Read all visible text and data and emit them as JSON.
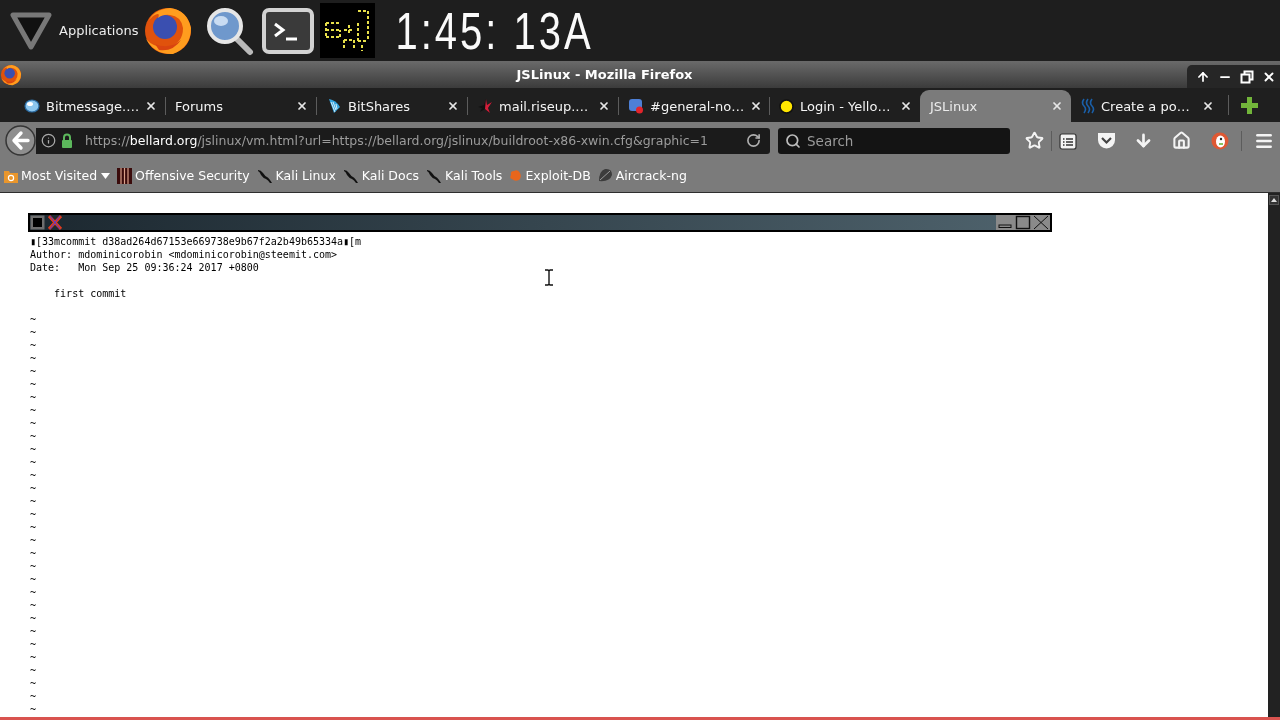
{
  "panel": {
    "menu_label": "Applications",
    "clock": "1:45: 13A"
  },
  "window": {
    "title": "JSLinux - Mozilla Firefox"
  },
  "tabs": [
    {
      "label": "Bitmessage.…",
      "selected": false
    },
    {
      "label": "Forums",
      "selected": false
    },
    {
      "label": "BitShares",
      "selected": false
    },
    {
      "label": "mail.riseup.…",
      "selected": false
    },
    {
      "label": "#general-no…",
      "selected": false
    },
    {
      "label": "Login - Yello…",
      "selected": false
    },
    {
      "label": "JSLinux",
      "selected": true
    },
    {
      "label": "Create a po…",
      "selected": false
    }
  ],
  "address_bar": {
    "scheme": "https://",
    "host": "bellard.org",
    "path": "/jslinux/vm.html?url=https://bellard.org/jslinux/buildroot-x86-xwin.cfg&graphic=1"
  },
  "search": {
    "placeholder": "Search"
  },
  "bookmarks": [
    {
      "label": "Most Visited",
      "kind": "folder"
    },
    {
      "label": "Offensive Security",
      "kind": "link"
    },
    {
      "label": "Kali Linux",
      "kind": "link"
    },
    {
      "label": "Kali Docs",
      "kind": "link"
    },
    {
      "label": "Kali Tools",
      "kind": "link"
    },
    {
      "label": "Exploit-DB",
      "kind": "link"
    },
    {
      "label": "Aircrack-ng",
      "kind": "link"
    }
  ],
  "terminal": {
    "header": [
      "▮[33mcommit d38ad264d67153e669738e9b67f2a2b49b65334a▮[m",
      "Author: mdominicorobin <mdominicorobin@steemit.com>",
      "Date:   Mon Sep 25 09:36:24 2017 +0800"
    ],
    "message": "first commit",
    "tildes": [
      "~",
      "~",
      "~",
      "~",
      "~",
      "~",
      "~",
      "~",
      "~",
      "~",
      "~",
      "~",
      "~",
      "~",
      "~",
      "~",
      "~",
      "~",
      "~",
      "~",
      "~",
      "~",
      "~",
      "~",
      "~",
      "~",
      "~",
      "~",
      "~",
      "~",
      "~"
    ]
  }
}
